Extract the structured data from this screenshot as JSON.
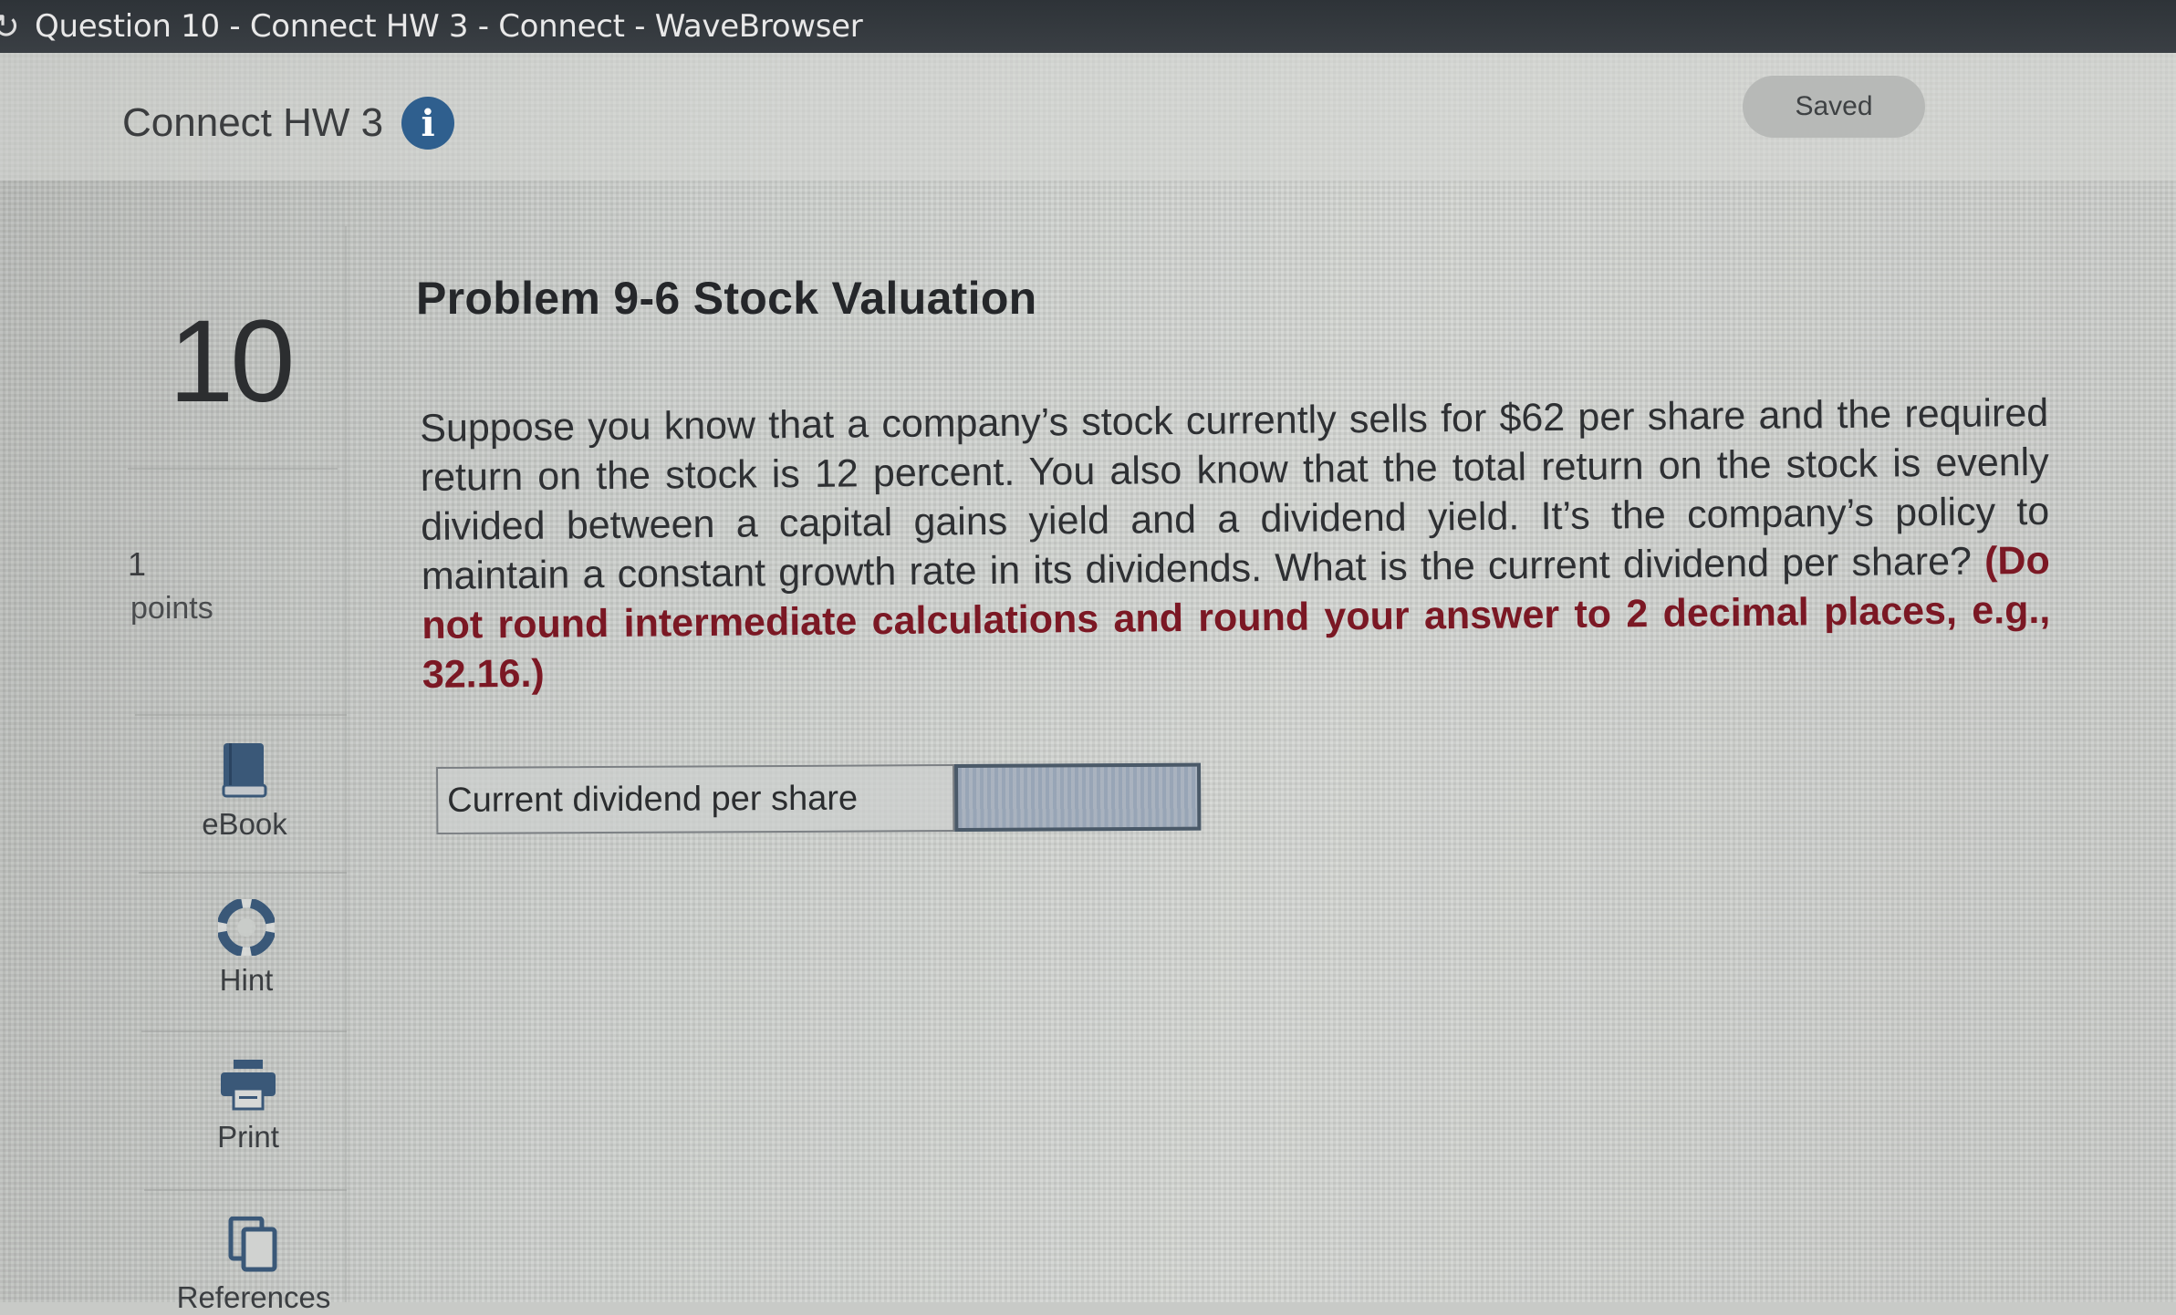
{
  "window": {
    "title": "Question 10 - Connect HW 3 - Connect - WaveBrowser"
  },
  "header": {
    "assignment_title": "Connect HW 3",
    "info_icon": "info-icon",
    "saved_status": "Saved"
  },
  "question": {
    "number": "10",
    "points_value": "1",
    "points_label": "points"
  },
  "tools": [
    {
      "label": "eBook",
      "icon": "book-icon"
    },
    {
      "label": "Hint",
      "icon": "lifebuoy-icon"
    },
    {
      "label": "Print",
      "icon": "printer-icon"
    },
    {
      "label": "References",
      "icon": "copy-icon"
    }
  ],
  "problem": {
    "title": "Problem 9-6 Stock Valuation",
    "body": "Suppose you know that a company’s stock currently sells for $62 per share and the required return on the stock is 12 percent. You also know that the total return on the stock is evenly divided between a capital gains yield and a dividend yield. It’s the company’s policy to maintain a constant growth rate in its dividends. What is the current dividend per share? ",
    "instruction": "(Do not round intermediate calculations and round your answer to 2 decimal places, e.g., 32.16.)"
  },
  "answer": {
    "label": "Current dividend per share",
    "value": ""
  },
  "colors": {
    "instruction": "#7b1824",
    "info_icon_bg": "#2f5f8e",
    "titlebar_bg": "#33383d"
  }
}
